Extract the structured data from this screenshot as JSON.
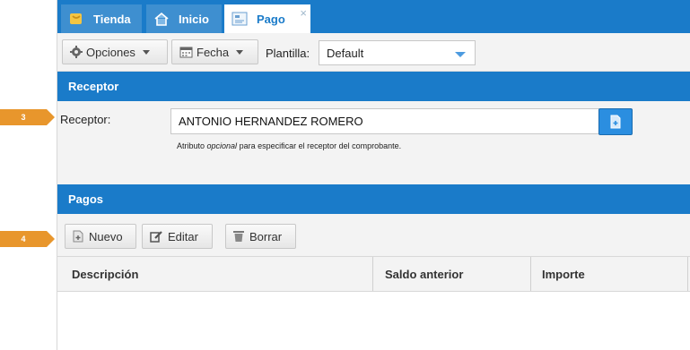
{
  "tabs": [
    {
      "label": "Tienda",
      "icon": "store-icon"
    },
    {
      "label": "Inicio",
      "icon": "home-icon"
    },
    {
      "label": "Pago",
      "icon": "form-icon",
      "close": "×"
    }
  ],
  "toolbar": {
    "options_label": "Opciones",
    "date_label": "Fecha",
    "template_label": "Plantilla:",
    "template_value": "Default"
  },
  "receptor_section": {
    "title": "Receptor",
    "field_label": "Receptor:",
    "field_value": "ANTONIO HERNANDEZ ROMERO",
    "hint_prefix": "Atributo ",
    "hint_emphasis": "opcional",
    "hint_suffix": " para especificar el receptor del comprobante."
  },
  "callouts": {
    "receptor": "3",
    "pagos": "4"
  },
  "pagos_section": {
    "title": "Pagos",
    "new_label": "Nuevo",
    "edit_label": "Editar",
    "delete_label": "Borrar",
    "columns": [
      "Descripción",
      "Saldo anterior",
      "Importe"
    ]
  },
  "colors": {
    "primary": "#1a7bc9",
    "callout": "#e8962c"
  }
}
